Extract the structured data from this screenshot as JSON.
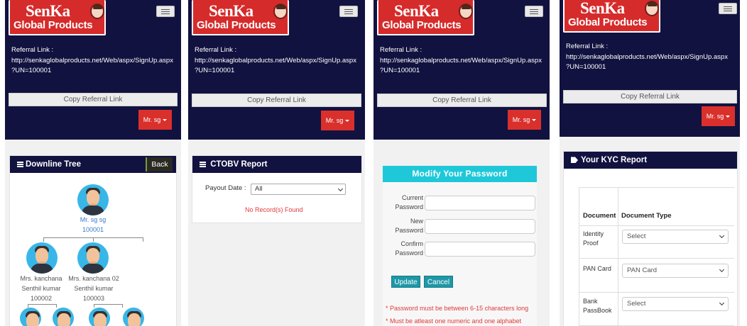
{
  "brand": {
    "name": "SenKa",
    "sub": "Global Products"
  },
  "header": {
    "referral_label": "Referral Link :",
    "referral_url": "http://senkaglobalproducts.net/Web/aspx/SignUp.aspx?UN=100001",
    "copy_button": "Copy Referral Link",
    "user_button": "Mr. sg"
  },
  "downline": {
    "title": "Downline Tree",
    "back": "Back",
    "root": {
      "name": "Mr. sg sg",
      "id": "100001"
    },
    "children": [
      {
        "name1": "Mrs. kanchana",
        "name2": "Senthil kumar",
        "id": "100002"
      },
      {
        "name1": "Mrs. kanchana 02",
        "name2": "Senthil kumar",
        "id": "100003"
      }
    ]
  },
  "ctobv": {
    "title": "CTOBV Report",
    "payout_label": "Payout Date :",
    "payout_value": "All",
    "empty": "No Record(s) Found"
  },
  "password": {
    "title": "Modify Your Password",
    "current_1": "Current",
    "current_2": "Password",
    "new_1": "New",
    "new_2": "Password",
    "confirm_1": "Confirm",
    "confirm_2": "Password",
    "update": "Update",
    "cancel": "Cancel",
    "note1": "* Password must be between 6-15 characters long",
    "note2": "* Must be atleast one numeric and one alphabet"
  },
  "kyc": {
    "title": "Your KYC Report",
    "col_document": "Document",
    "col_type": "Document Type",
    "rows": [
      {
        "doc1": "Identity",
        "doc2": "Proof",
        "value": "Select"
      },
      {
        "doc1": "PAN Card",
        "doc2": "",
        "value": "PAN Card"
      },
      {
        "doc1": "Bank",
        "doc2": "PassBook",
        "value": "Select"
      }
    ]
  },
  "colors": {
    "navy": "#121240",
    "red": "#d9302c",
    "teal": "#1ec8d8",
    "button_teal": "#1e98a8"
  }
}
